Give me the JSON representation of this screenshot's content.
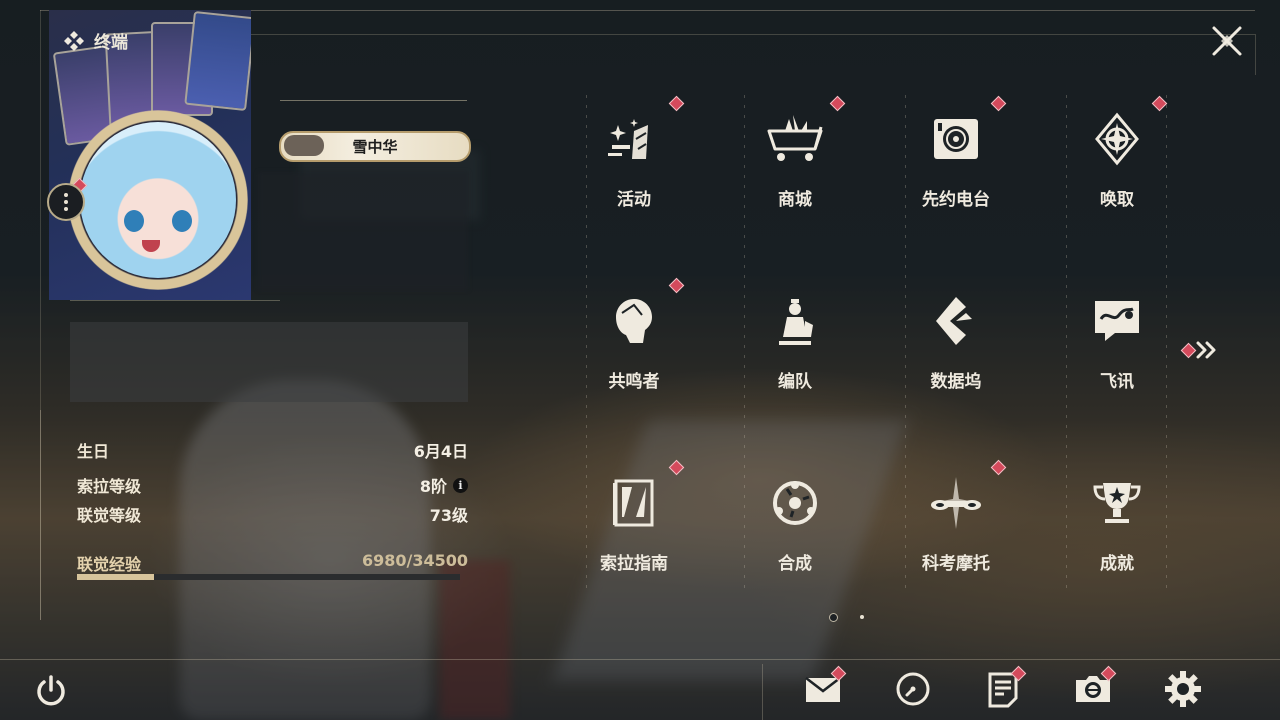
{
  "header": {
    "title": "终端"
  },
  "profile": {
    "name": "雪中华",
    "info": [
      {
        "label": "生日",
        "value": "6月4日"
      },
      {
        "label": "索拉等级",
        "value": "8阶",
        "info_icon": "info-icon"
      },
      {
        "label": "联觉等级",
        "value": "73级"
      }
    ],
    "exp": {
      "label": "联觉经验",
      "value": "6980/34500",
      "fraction": 0.2023
    }
  },
  "menu": [
    {
      "label": "活动",
      "icon": "sparkle-activity-icon",
      "badge": true
    },
    {
      "label": "商城",
      "icon": "shopping-cart-icon",
      "badge": true
    },
    {
      "label": "先约电台",
      "icon": "radio-speaker-icon",
      "badge": true
    },
    {
      "label": "唤取",
      "icon": "compass-star-icon",
      "badge": true
    },
    {
      "label": "共鸣者",
      "icon": "character-head-icon",
      "badge": true
    },
    {
      "label": "编队",
      "icon": "chess-pieces-icon",
      "badge": false
    },
    {
      "label": "数据坞",
      "icon": "data-dock-icon",
      "badge": false
    },
    {
      "label": "飞讯",
      "icon": "message-bubble-icon",
      "badge": false
    },
    {
      "label": "索拉指南",
      "icon": "guide-book-icon",
      "badge": true
    },
    {
      "label": "合成",
      "icon": "synthesis-ring-icon",
      "badge": false
    },
    {
      "label": "科考摩托",
      "icon": "motorcycle-icon",
      "badge": true
    },
    {
      "label": "成就",
      "icon": "trophy-icon",
      "badge": false
    }
  ],
  "pager": {
    "pages": 2,
    "current": 1
  },
  "bottom_bar": [
    {
      "name": "mail",
      "icon": "mail-icon",
      "badge": true
    },
    {
      "name": "history",
      "icon": "clock-icon",
      "badge": false
    },
    {
      "name": "notes",
      "icon": "notice-icon",
      "badge": true
    },
    {
      "name": "camera",
      "icon": "camera-icon",
      "badge": true
    },
    {
      "name": "settings",
      "icon": "gear-icon",
      "badge": false
    }
  ],
  "colors": {
    "accent": "#d7c49b",
    "badge": "#d44a5c",
    "text": "#efeadf"
  }
}
